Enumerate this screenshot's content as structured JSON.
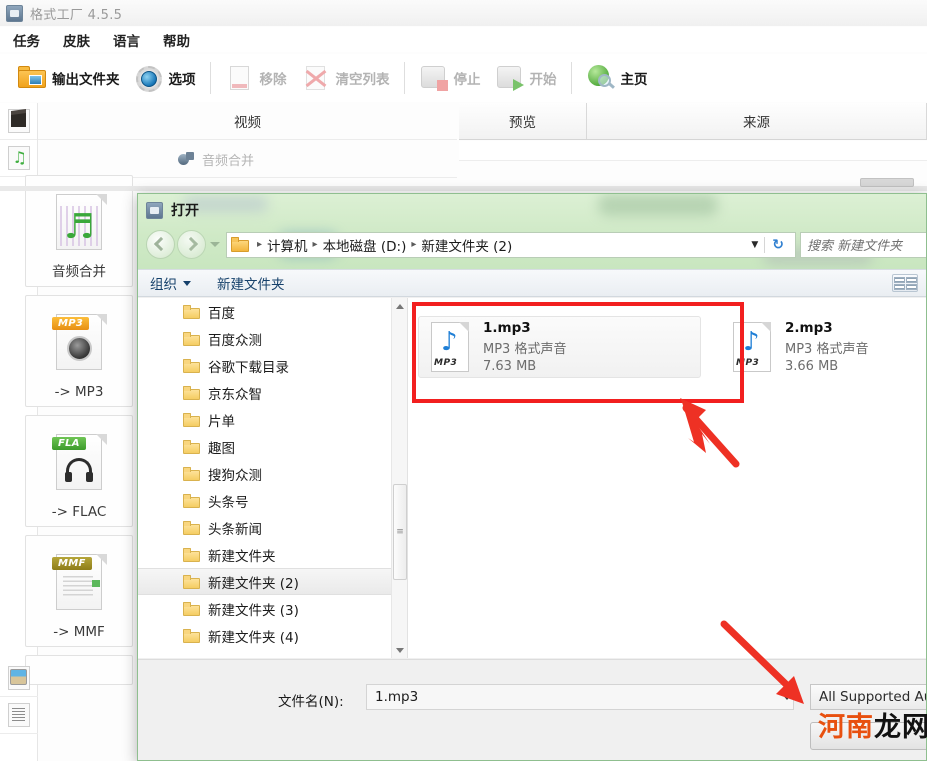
{
  "app": {
    "title": "格式工厂 4.5.5",
    "title_icon": "app-icon",
    "menu": [
      {
        "label": "任务"
      },
      {
        "label": "皮肤"
      },
      {
        "label": "语言"
      },
      {
        "label": "帮助"
      }
    ],
    "toolbar": [
      {
        "label": "输出文件夹",
        "icon": "output-folder-icon",
        "enabled": true
      },
      {
        "label": "选项",
        "icon": "options-gear-icon",
        "enabled": true
      },
      {
        "label": "移除",
        "icon": "remove-page-icon",
        "enabled": false
      },
      {
        "label": "清空列表",
        "icon": "clear-list-icon",
        "enabled": false
      },
      {
        "label": "停止",
        "icon": "stop-icon",
        "enabled": false
      },
      {
        "label": "开始",
        "icon": "start-icon",
        "enabled": false
      },
      {
        "label": "主页",
        "icon": "home-globe-icon",
        "enabled": true
      }
    ],
    "categories": {
      "video": {
        "label": "视频",
        "icon": "film-clapper-icon"
      },
      "audio": {
        "label": "音频合并",
        "icon": "audio-merge-icon",
        "rail_icon": "music-note-icon"
      },
      "picture": {
        "icon": "picture-icon"
      },
      "document": {
        "icon": "document-icon"
      }
    },
    "columns": [
      {
        "label": "预览"
      },
      {
        "label": "来源"
      }
    ],
    "tiles": [
      {
        "label": "音频合并",
        "icon": "audio-merge-tile-icon",
        "tag": ""
      },
      {
        "label": "-> MP3",
        "icon": "mp3-tile-icon",
        "tag": "MP3"
      },
      {
        "label": "-> FLAC",
        "icon": "flac-tile-icon",
        "tag": "FLA"
      },
      {
        "label": "-> MMF",
        "icon": "mmf-tile-icon",
        "tag": "MMF"
      }
    ]
  },
  "dialog": {
    "title": "打开",
    "title_icon": "dialog-app-icon",
    "nav": {
      "back_icon": "back-arrow-icon",
      "forward_icon": "forward-arrow-icon",
      "history_icon": "history-dropdown-icon",
      "refresh_icon": "refresh-icon",
      "dropdown_icon": "address-dropdown-icon"
    },
    "breadcrumb": {
      "folder_icon": "folder-icon",
      "items": [
        "计算机",
        "本地磁盘 (D:)",
        "新建文件夹 (2)"
      ],
      "separator": "▸"
    },
    "search": {
      "placeholder": "搜索 新建文件夹",
      "icon": "search-icon"
    },
    "commandbar": {
      "organize": "组织",
      "new_folder": "新建文件夹",
      "view_icon": "view-mode-icon"
    },
    "tree": {
      "items": [
        {
          "label": "百度",
          "selected": false
        },
        {
          "label": "百度众测",
          "selected": false
        },
        {
          "label": "谷歌下载目录",
          "selected": false
        },
        {
          "label": "京东众智",
          "selected": false
        },
        {
          "label": "片单",
          "selected": false
        },
        {
          "label": "趣图",
          "selected": false
        },
        {
          "label": "搜狗众测",
          "selected": false
        },
        {
          "label": "头条号",
          "selected": false
        },
        {
          "label": "头条新闻",
          "selected": false
        },
        {
          "label": "新建文件夹",
          "selected": false
        },
        {
          "label": "新建文件夹 (2)",
          "selected": true
        },
        {
          "label": "新建文件夹 (3)",
          "selected": false
        },
        {
          "label": "新建文件夹 (4)",
          "selected": false
        }
      ],
      "scrollbar": {
        "up_icon": "scroll-up-icon",
        "down_icon": "scroll-down-icon",
        "thumb_grip": "≡"
      }
    },
    "files": [
      {
        "name": "1.mp3",
        "type": "MP3 格式声音",
        "size": "7.63 MB",
        "icon": "mp3-file-icon",
        "icon_tag": "MP3",
        "selected": true
      },
      {
        "name": "2.mp3",
        "type": "MP3 格式声音",
        "size": "3.66 MB",
        "icon": "mp3-file-icon",
        "icon_tag": "MP3",
        "selected": false
      }
    ],
    "footer": {
      "filename_label": "文件名(N):",
      "filename_value": "1.mp3",
      "filename_dropdown_icon": "filename-dropdown-icon",
      "filter_value": "All Supported Au",
      "open_button": ""
    }
  },
  "annotations": {
    "highlight_color": "#f21f1f",
    "arrow_color": "#ee3124",
    "arrows": [
      {
        "name": "arrow-to-file",
        "direction": "up-left"
      },
      {
        "name": "arrow-to-filter",
        "direction": "down-right"
      }
    ],
    "watermark": {
      "part1": "河南",
      "part2": "龙网",
      "color1": "#e8500f",
      "color2": "#121212"
    }
  }
}
